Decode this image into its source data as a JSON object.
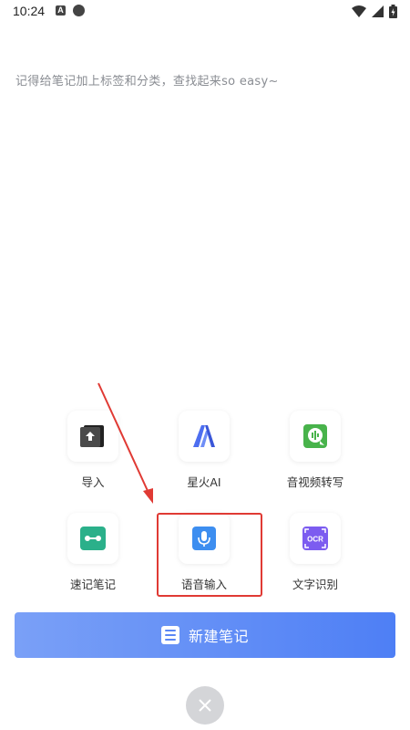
{
  "status_bar": {
    "time": "10:24",
    "left_icons": [
      "a-badge-icon",
      "bomb-icon"
    ],
    "right_icons": [
      "wifi-icon",
      "signal-icon",
      "battery-icon"
    ]
  },
  "hint": "记得给笔记加上标签和分类，查找起来so easy~",
  "tools": [
    {
      "label": "导入",
      "icon": "import-icon"
    },
    {
      "label": "星火AI",
      "icon": "spark-ai-icon"
    },
    {
      "label": "音视频转写",
      "icon": "av-transcribe-icon"
    },
    {
      "label": "速记笔记",
      "icon": "quick-note-icon"
    },
    {
      "label": "语音输入",
      "icon": "microphone-icon"
    },
    {
      "label": "文字识别",
      "icon": "ocr-icon"
    }
  ],
  "ocr_badge": "OCR",
  "new_note_button": "新建笔记",
  "colors": {
    "accent": "#4e7ff5",
    "highlight": "#e03a34",
    "import_icon": "#3a3a3a",
    "spark_icon": "#4d6ef0",
    "av_icon": "#48b34b",
    "quick_note_icon": "#2bb08a",
    "mic_icon": "#3d8ef0",
    "ocr_icon": "#7c5cf0"
  }
}
